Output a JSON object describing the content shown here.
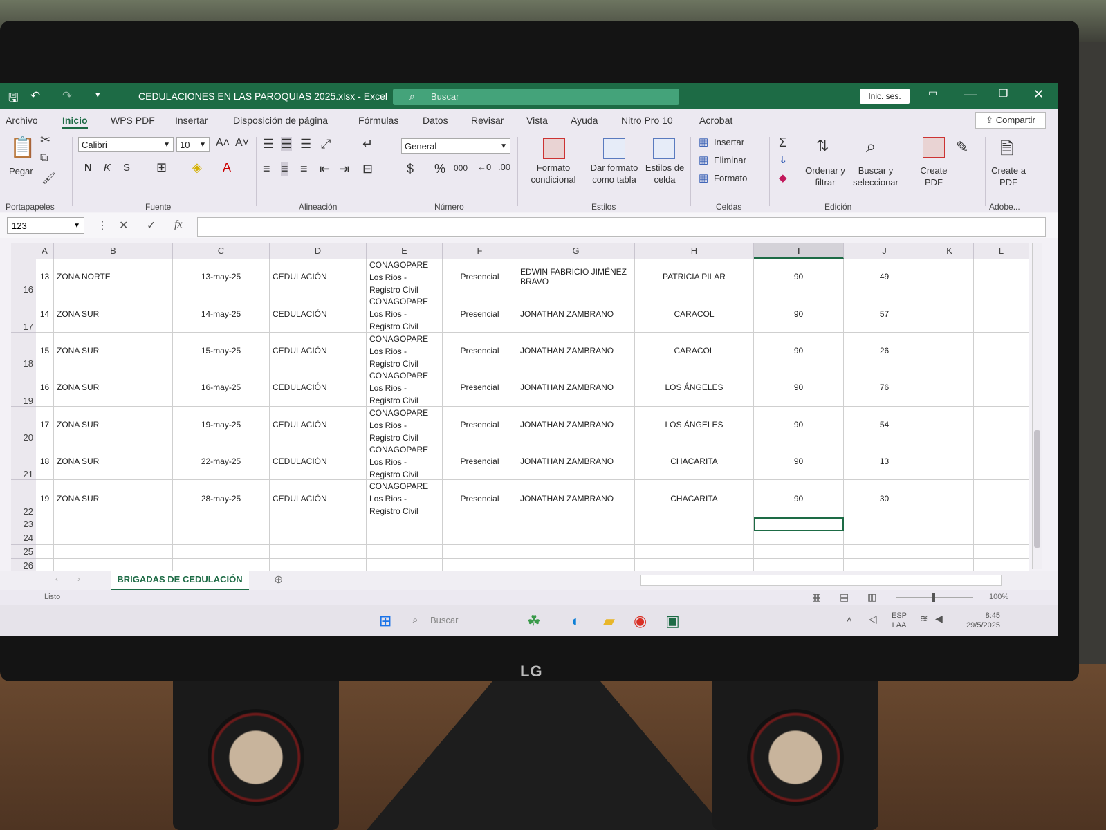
{
  "window": {
    "title": "CEDULACIONES EN LAS PAROQUIAS 2025.xlsx  -  Excel",
    "search_placeholder": "Buscar",
    "signin": "Inic. ses."
  },
  "menu": {
    "tabs": [
      "Archivo",
      "Inicio",
      "WPS PDF",
      "Insertar",
      "Disposición de página",
      "Fórmulas",
      "Datos",
      "Revisar",
      "Vista",
      "Ayuda",
      "Nitro Pro 10",
      "Acrobat"
    ],
    "share": "Compartir"
  },
  "ribbon": {
    "paste": "Pegar",
    "groups": [
      "Portapapeles",
      "Fuente",
      "Alineación",
      "Número",
      "Estilos",
      "Celdas",
      "Edición",
      "Adobe..."
    ],
    "font_name": "Calibri",
    "font_size": "10",
    "bold": "N",
    "italic": "K",
    "underline": "S",
    "number_format": "General",
    "conditional_format": "Formato condicional",
    "format_as_table": "Dar formato como tabla",
    "cell_styles": "Estilos de celda",
    "insert": "Insertar",
    "delete": "Eliminar",
    "format": "Formato",
    "sort_filter": "Ordenar y filtrar",
    "find_select": "Buscar y seleccionar",
    "create_pdf": "Create PDF",
    "create_a_pdf": "Create a PDF"
  },
  "formula_bar": {
    "name_box": "123",
    "fx": "fx",
    "value": ""
  },
  "columns": [
    "A",
    "B",
    "C",
    "D",
    "E",
    "F",
    "G",
    "H",
    "I",
    "J",
    "K",
    "L"
  ],
  "rows": [
    {
      "row": "16",
      "num": "13",
      "zona": "ZONA NORTE",
      "fecha": "13-may-25",
      "tipo": "CEDULACIÓN",
      "inst1": "CONAGOPARE",
      "inst2": "Los Rios -",
      "inst3": "Registro Civil",
      "modo": "Presencial",
      "resp": "EDWIN FABRICIO JIMÉNEZ BRAVO",
      "parroquia": "PATRICIA PILAR",
      "meta": "90",
      "logro": "49"
    },
    {
      "row": "17",
      "num": "14",
      "zona": "ZONA SUR",
      "fecha": "14-may-25",
      "tipo": "CEDULACIÓN",
      "inst1": "CONAGOPARE",
      "inst2": "Los Rios -",
      "inst3": "Registro Civil",
      "modo": "Presencial",
      "resp": "JONATHAN ZAMBRANO",
      "parroquia": "CARACOL",
      "meta": "90",
      "logro": "57"
    },
    {
      "row": "18",
      "num": "15",
      "zona": "ZONA SUR",
      "fecha": "15-may-25",
      "tipo": "CEDULACIÓN",
      "inst1": "CONAGOPARE",
      "inst2": "Los Rios -",
      "inst3": "Registro Civil",
      "modo": "Presencial",
      "resp": "JONATHAN ZAMBRANO",
      "parroquia": "CARACOL",
      "meta": "90",
      "logro": "26"
    },
    {
      "row": "19",
      "num": "16",
      "zona": "ZONA SUR",
      "fecha": "16-may-25",
      "tipo": "CEDULACIÓN",
      "inst1": "CONAGOPARE",
      "inst2": "Los Rios -",
      "inst3": "Registro Civil",
      "modo": "Presencial",
      "resp": "JONATHAN ZAMBRANO",
      "parroquia": "LOS ÁNGELES",
      "meta": "90",
      "logro": "76"
    },
    {
      "row": "20",
      "num": "17",
      "zona": "ZONA SUR",
      "fecha": "19-may-25",
      "tipo": "CEDULACIÓN",
      "inst1": "CONAGOPARE",
      "inst2": "Los Rios -",
      "inst3": "Registro Civil",
      "modo": "Presencial",
      "resp": "JONATHAN ZAMBRANO",
      "parroquia": "LOS ÁNGELES",
      "meta": "90",
      "logro": "54"
    },
    {
      "row": "21",
      "num": "18",
      "zona": "ZONA SUR",
      "fecha": "22-may-25",
      "tipo": "CEDULACIÓN",
      "inst1": "CONAGOPARE",
      "inst2": "Los Rios -",
      "inst3": "Registro Civil",
      "modo": "Presencial",
      "resp": "JONATHAN ZAMBRANO",
      "parroquia": "CHACARITA",
      "meta": "90",
      "logro": "13"
    },
    {
      "row": "22",
      "num": "19",
      "zona": "ZONA SUR",
      "fecha": "28-may-25",
      "tipo": "CEDULACIÓN",
      "inst1": "CONAGOPARE",
      "inst2": "Los Rios -",
      "inst3": "Registro Civil",
      "modo": "Presencial",
      "resp": "JONATHAN ZAMBRANO",
      "parroquia": "CHACARITA",
      "meta": "90",
      "logro": "30"
    }
  ],
  "empty_rows": [
    "23",
    "24",
    "25",
    "26"
  ],
  "sheet_tab": "BRIGADAS DE CEDULACIÓN",
  "status": {
    "ready": "Listo",
    "zoom": "100%"
  },
  "taskbar": {
    "search": "Buscar",
    "lang1": "ESP",
    "lang2": "LAA",
    "time": "8:45",
    "date": "29/5/2025"
  },
  "monitor_brand": "LG"
}
